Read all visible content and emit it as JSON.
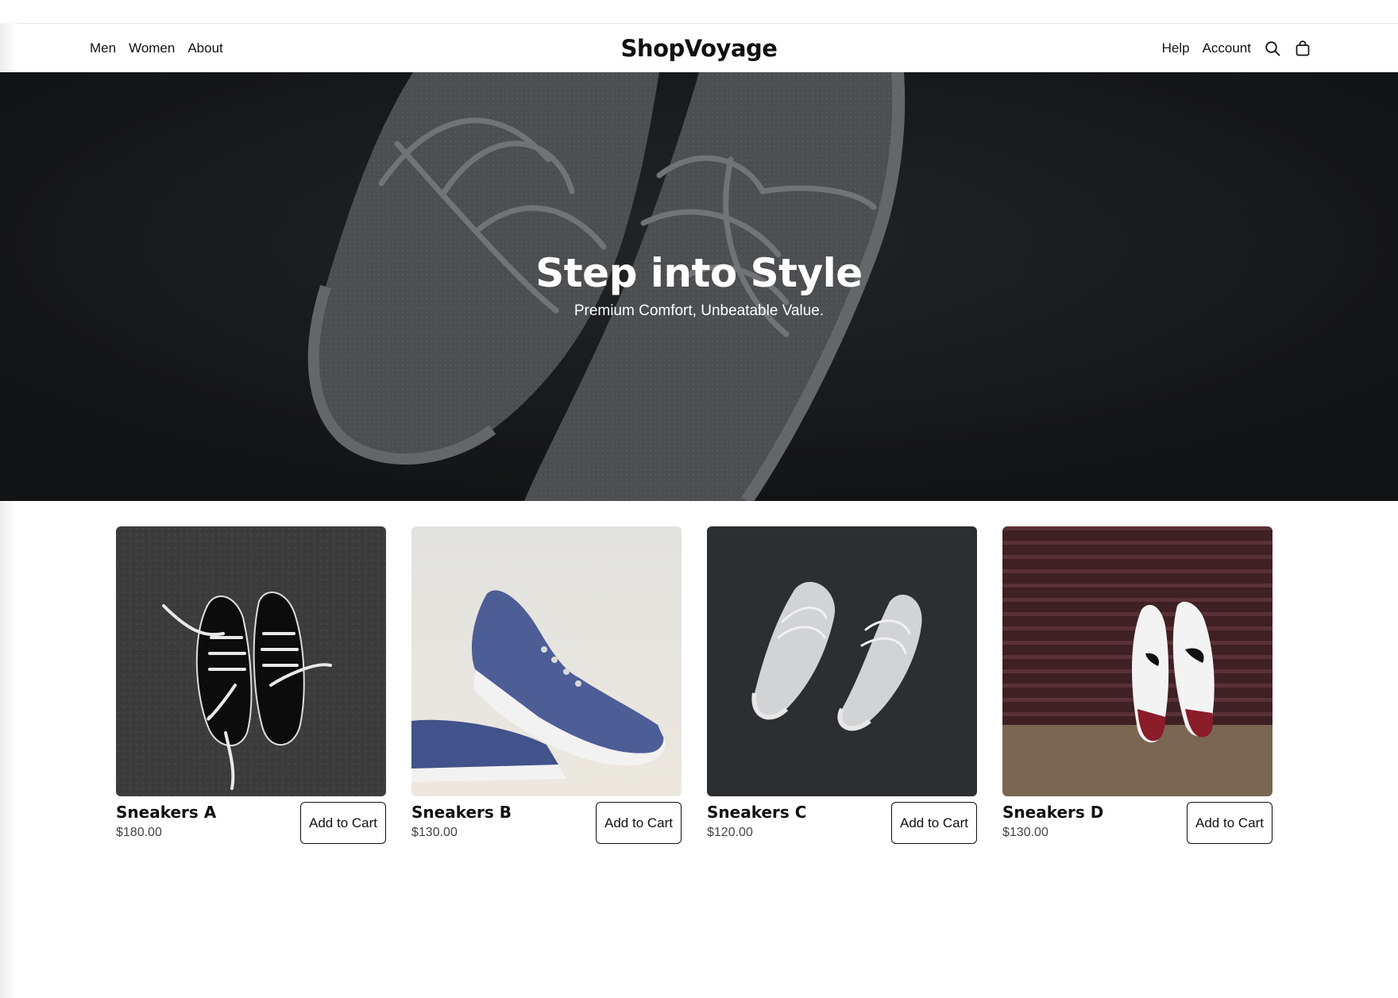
{
  "nav": {
    "left_links": [
      "Men",
      "Women",
      "About"
    ],
    "brand": "ShopVoyage",
    "right_links": [
      "Help",
      "Account"
    ],
    "icons": [
      "search-icon",
      "shopping-bag-icon"
    ]
  },
  "hero": {
    "title": "Step into Style",
    "subtitle": "Premium Comfort, Unbeatable Value."
  },
  "products": [
    {
      "name": "Sneakers A",
      "price": "$180.00",
      "button": "Add to Cart",
      "image": "black-sneakers-on-asphalt"
    },
    {
      "name": "Sneakers B",
      "price": "$130.00",
      "button": "Add to Cart",
      "image": "blue-canvas-sneaker"
    },
    {
      "name": "Sneakers C",
      "price": "$120.00",
      "button": "Add to Cart",
      "image": "white-knit-sneakers"
    },
    {
      "name": "Sneakers D",
      "price": "$130.00",
      "button": "Add to Cart",
      "image": "white-red-sneakers"
    }
  ],
  "colors": {
    "text": "#111111",
    "hero_bg": "#1c1e20",
    "price": "#444444"
  }
}
